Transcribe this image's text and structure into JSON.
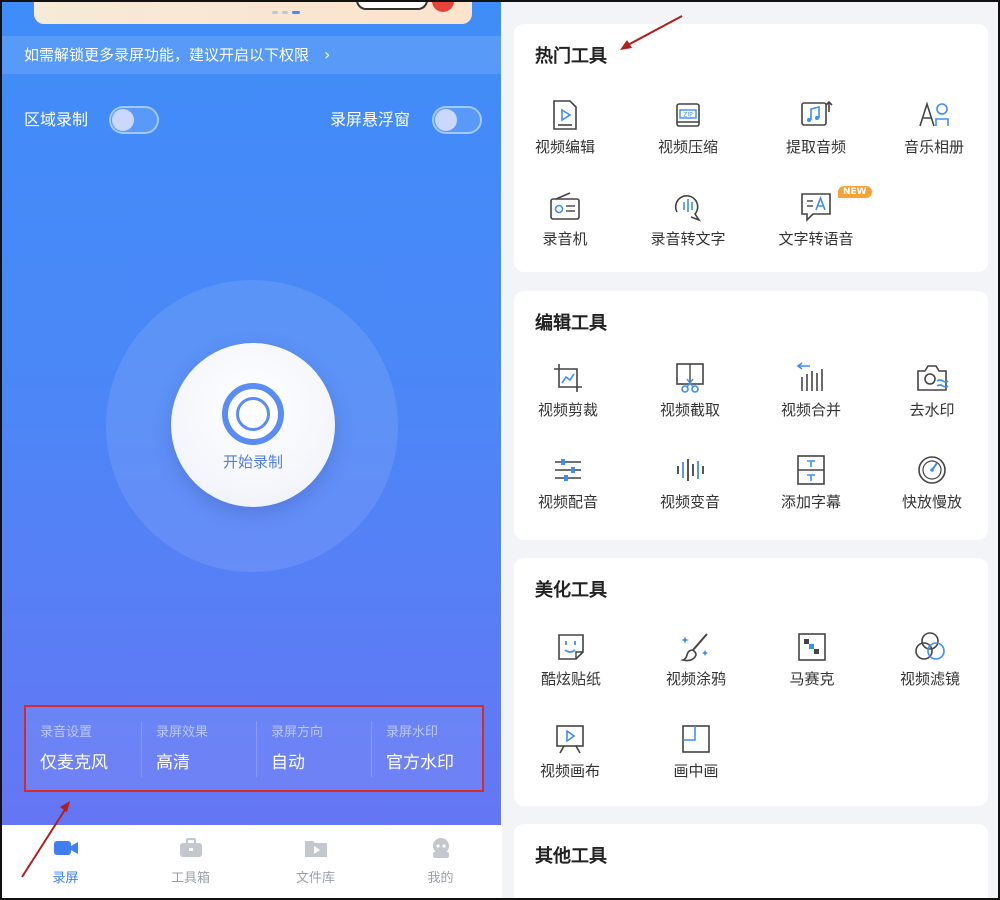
{
  "left": {
    "permission_banner": "如需解锁更多录屏功能，建议开启以下权限",
    "region_record": "区域录制",
    "floating_window": "录屏悬浮窗",
    "start_record": "开始录制",
    "settings": [
      {
        "key": "录音设置",
        "value": "仅麦克风"
      },
      {
        "key": "录屏效果",
        "value": "高清"
      },
      {
        "key": "录屏方向",
        "value": "自动"
      },
      {
        "key": "录屏水印",
        "value": "官方水印"
      }
    ],
    "tabs": [
      {
        "label": "录屏",
        "icon": "video-camera-icon",
        "active": true
      },
      {
        "label": "工具箱",
        "icon": "toolbox-icon",
        "active": false
      },
      {
        "label": "文件库",
        "icon": "folder-video-icon",
        "active": false
      },
      {
        "label": "我的",
        "icon": "profile-icon",
        "active": false
      }
    ]
  },
  "right": {
    "sections": [
      {
        "title": "热门工具",
        "tools": [
          {
            "label": "视频编辑",
            "icon": "video-edit-icon"
          },
          {
            "label": "视频压缩",
            "icon": "zip-compress-icon"
          },
          {
            "label": "提取音频",
            "icon": "extract-audio-icon"
          },
          {
            "label": "音乐相册",
            "icon": "music-album-icon"
          },
          {
            "label": "录音机",
            "icon": "radio-recorder-icon"
          },
          {
            "label": "录音转文字",
            "icon": "speech-to-text-icon"
          },
          {
            "label": "文字转语音",
            "icon": "text-to-speech-icon",
            "badge": "NEW"
          }
        ]
      },
      {
        "title": "编辑工具",
        "tools": [
          {
            "label": "视频剪裁",
            "icon": "crop-icon"
          },
          {
            "label": "视频截取",
            "icon": "scissors-icon"
          },
          {
            "label": "视频合并",
            "icon": "merge-bars-icon"
          },
          {
            "label": "去水印",
            "icon": "camera-remove-watermark-icon"
          },
          {
            "label": "视频配音",
            "icon": "sliders-icon"
          },
          {
            "label": "视频变音",
            "icon": "waveform-icon"
          },
          {
            "label": "添加字幕",
            "icon": "subtitle-icon"
          },
          {
            "label": "快放慢放",
            "icon": "speed-gauge-icon"
          }
        ]
      },
      {
        "title": "美化工具",
        "tools": [
          {
            "label": "酷炫贴纸",
            "icon": "sticker-face-icon"
          },
          {
            "label": "视频涂鸦",
            "icon": "paintbrush-icon"
          },
          {
            "label": "马赛克",
            "icon": "mosaic-icon"
          },
          {
            "label": "视频滤镜",
            "icon": "filter-circles-icon"
          },
          {
            "label": "视频画布",
            "icon": "canvas-play-icon"
          },
          {
            "label": "画中画",
            "icon": "picture-in-picture-icon"
          }
        ]
      },
      {
        "title": "其他工具",
        "tools": []
      }
    ]
  },
  "colors": {
    "accent": "#3f7ff3",
    "highlight_box": "#d42a2a",
    "arrow": "#b01e1e"
  }
}
